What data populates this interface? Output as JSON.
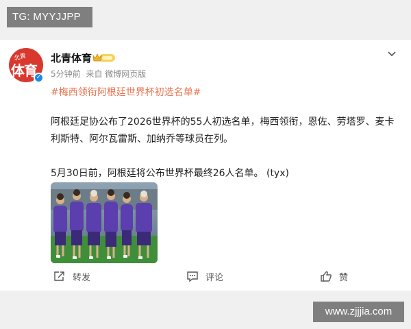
{
  "watermarks": {
    "top_left": "TG: MYYJJPP",
    "bottom_right": "www.zjjjia.com"
  },
  "post": {
    "avatar": {
      "small_text": "北青",
      "big_text": "体育"
    },
    "user_name": "北青体育",
    "time": "5分钟前",
    "source": "来自 微博网页版",
    "hashtag": "#梅西领衔阿根廷世界杯初选名单#",
    "paragraph1": "阿根廷足协公布了2026世界杯的55人初选名单，梅西领衔，恩佐、劳塔罗、麦卡利斯特、阿尔瓦雷斯、加纳乔等球员在列。",
    "paragraph2": "5月30日前，阿根廷将公布世界杯最终26人名单。  (tyx)",
    "actions": {
      "repost": "转发",
      "comment": "评论",
      "like": "赞"
    }
  },
  "colors": {
    "hashtag": "#eb7350",
    "avatar_bg": "#d9382e",
    "verified": "#1e88e5",
    "vip_gold": "#f0b429",
    "jersey": "#5b3fae",
    "pitch": "#3f8f3a"
  },
  "icons": [
    "avatar-logo",
    "verified-icon",
    "vip-crown-icon",
    "chevron-down-icon",
    "repost-icon",
    "comment-icon",
    "like-icon"
  ]
}
